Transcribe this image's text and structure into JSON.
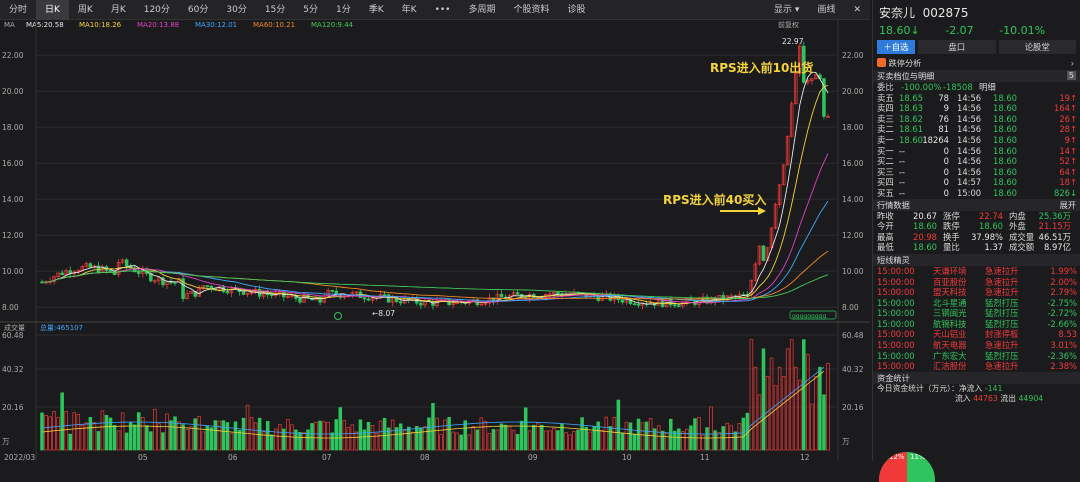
{
  "toolbar": {
    "tabs": [
      "分时",
      "日K",
      "周K",
      "月K",
      "120分",
      "60分",
      "30分",
      "15分",
      "5分",
      "1分",
      "季K",
      "年K",
      "•••",
      "多周期",
      "个股资料",
      "诊股"
    ],
    "active": 1,
    "display": "显示 ▾",
    "draw": "画线"
  },
  "ma_legend": {
    "label": "MA",
    "items": [
      {
        "t": "MA5:20.58",
        "c": "#e8e8e8"
      },
      {
        "t": "MA10:18.26",
        "c": "#f3d23a"
      },
      {
        "t": "MA20:13.88",
        "c": "#e040c8"
      },
      {
        "t": "MA30:12.01",
        "c": "#3fa6ff"
      },
      {
        "t": "MA60:10.21",
        "c": "#f08a24"
      },
      {
        "t": "MA120:9.44",
        "c": "#43c85a"
      }
    ],
    "fq": "前复权"
  },
  "vol_legend": {
    "label": "成交量",
    "total": "总量:465107"
  },
  "price_axis": [
    "22.00",
    "20.00",
    "18.00",
    "16.00",
    "14.00",
    "12.00",
    "10.00",
    "8.00"
  ],
  "vol_axis": [
    "60.48",
    "40.32",
    "20.16",
    "万"
  ],
  "date_axis": [
    "2022/03",
    "05",
    "06",
    "07",
    "08",
    "09",
    "10",
    "11",
    "12"
  ],
  "annotations": {
    "high": "22.97",
    "low": "←8.07",
    "sell": "RPS进入前10出货",
    "buy": "RPS进入前40买入",
    "volbox": "ggggggggg"
  },
  "stock": {
    "name": "安奈儿",
    "code": "002875",
    "price": "18.60",
    "arrow": "↓",
    "chg": "-2.07",
    "pct": "-10.01%"
  },
  "tabs": {
    "add": "＋自选",
    "mid": "盘口",
    "right": "论股堂"
  },
  "limit_analysis": {
    "text": "跌停分析",
    "more": "›"
  },
  "orderbook": {
    "title": "买卖档位与明细",
    "badge": "5",
    "ratio_label": "委比",
    "ratio": "-100.00%",
    "diff": "-18508",
    "detail": "明细",
    "asks": [
      {
        "n": "卖五",
        "p": "18.65",
        "v": "78"
      },
      {
        "n": "卖四",
        "p": "18.63",
        "v": "9"
      },
      {
        "n": "卖三",
        "p": "18.62",
        "v": "76"
      },
      {
        "n": "卖二",
        "p": "18.61",
        "v": "81"
      },
      {
        "n": "卖一",
        "p": "18.60",
        "v": "18264"
      }
    ],
    "bids": [
      {
        "n": "买一",
        "p": "--",
        "v": "0"
      },
      {
        "n": "买二",
        "p": "--",
        "v": "0"
      },
      {
        "n": "买三",
        "p": "--",
        "v": "0"
      },
      {
        "n": "买四",
        "p": "--",
        "v": "0"
      },
      {
        "n": "买五",
        "p": "--",
        "v": "0"
      }
    ],
    "ticks": [
      {
        "t": "14:56",
        "p": "18.60",
        "v": "19↑",
        "c": "red"
      },
      {
        "t": "14:56",
        "p": "18.60",
        "v": "164↑",
        "c": "red"
      },
      {
        "t": "14:56",
        "p": "18.60",
        "v": "26↑",
        "c": "red"
      },
      {
        "t": "14:56",
        "p": "18.60",
        "v": "28↑",
        "c": "red"
      },
      {
        "t": "14:56",
        "p": "18.60",
        "v": "9↑",
        "c": "red"
      },
      {
        "t": "14:56",
        "p": "18.60",
        "v": "14↑",
        "c": "red"
      },
      {
        "t": "14:56",
        "p": "18.60",
        "v": "52↑",
        "c": "red"
      },
      {
        "t": "14:56",
        "p": "18.60",
        "v": "64↑",
        "c": "red"
      },
      {
        "t": "14:57",
        "p": "18.60",
        "v": "18↑",
        "c": "red"
      },
      {
        "t": "15:00",
        "p": "18.60",
        "v": "826↓",
        "c": "green"
      }
    ]
  },
  "quote": {
    "title": "行情数据",
    "expand": "展开",
    "rows": [
      [
        {
          "l": "昨收",
          "v": "20.67",
          "c": "white"
        },
        {
          "l": "涨停",
          "v": "22.74",
          "c": "red"
        },
        {
          "l": "内盘",
          "v": "25.36万",
          "c": "green"
        }
      ],
      [
        {
          "l": "今开",
          "v": "18.60",
          "c": "green"
        },
        {
          "l": "跌停",
          "v": "18.60",
          "c": "green"
        },
        {
          "l": "外盘",
          "v": "21.15万",
          "c": "red"
        }
      ],
      [
        {
          "l": "最高",
          "v": "20.98",
          "c": "red"
        },
        {
          "l": "换手",
          "v": "37.98%",
          "c": "white"
        },
        {
          "l": "成交量",
          "v": "46.51万",
          "c": "white"
        }
      ],
      [
        {
          "l": "最低",
          "v": "18.60",
          "c": "green"
        },
        {
          "l": "量比",
          "v": "1.37",
          "c": "white"
        },
        {
          "l": "成交额",
          "v": "8.97亿",
          "c": "white"
        }
      ]
    ]
  },
  "wizard": {
    "title": "短线精灵",
    "rows": [
      {
        "t": "15:00:00",
        "n": "天谦环境",
        "e": "急速拉升",
        "v": "1.99%",
        "c": "red"
      },
      {
        "t": "15:00:00",
        "n": "百亚股份",
        "e": "急速拉升",
        "v": "2.00%",
        "c": "red"
      },
      {
        "t": "15:00:00",
        "n": "盟天科技",
        "e": "急速拉升",
        "v": "2.79%",
        "c": "red"
      },
      {
        "t": "15:00:00",
        "n": "北斗星通",
        "e": "猛烈打压",
        "v": "-2.75%",
        "c": "green"
      },
      {
        "t": "15:00:00",
        "n": "三钢闽光",
        "e": "猛烈打压",
        "v": "-2.72%",
        "c": "green"
      },
      {
        "t": "15:00:00",
        "n": "航锦科技",
        "e": "猛烈打压",
        "v": "-2.66%",
        "c": "green"
      },
      {
        "t": "15:00:00",
        "n": "天山铝业",
        "e": "封涨停板",
        "v": "8.53",
        "c": "red"
      },
      {
        "t": "15:00:00",
        "n": "航天电器",
        "e": "急速拉升",
        "v": "3.01%",
        "c": "red"
      },
      {
        "t": "15:00:00",
        "n": "广东宏大",
        "e": "猛烈打压",
        "v": "-2.36%",
        "c": "green"
      },
      {
        "t": "15:00:00",
        "n": "汇洁股份",
        "e": "急速拉升",
        "v": "2.38%",
        "c": "red"
      }
    ]
  },
  "funds": {
    "title": "资金统计",
    "today": "今日资金统计（万元）：",
    "net_l": "净流入",
    "net": "-141",
    "in_l": "流入",
    "in": "44763",
    "out_l": "流出",
    "out": "44904",
    "pie": [
      "12%",
      "11%"
    ]
  }
}
